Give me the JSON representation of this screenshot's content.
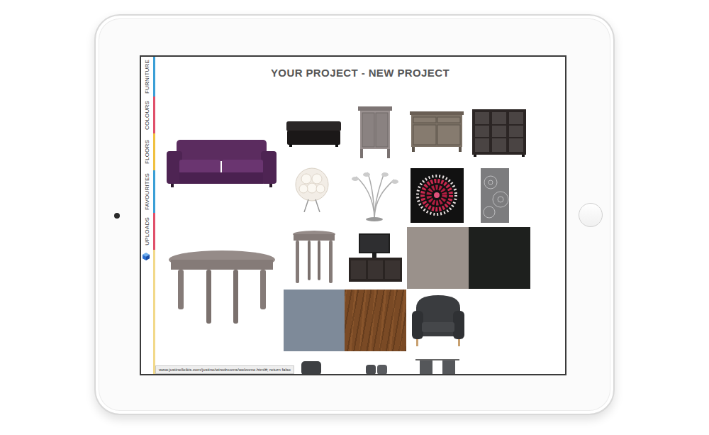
{
  "title": "YOUR PROJECT - NEW PROJECT",
  "sidebar": {
    "items": [
      {
        "label": "FURNITURE",
        "color": "#3b9fd6"
      },
      {
        "label": "COLOURS",
        "color": "#e0506a"
      },
      {
        "label": "FLOORS",
        "color": "#f0c040"
      },
      {
        "label": "FAVOURITES",
        "color": "#3b9fd6"
      },
      {
        "label": "UPLOADS",
        "color": "#e0506a"
      }
    ]
  },
  "swatches": [
    {
      "kind": "paint",
      "color": "#9a918b"
    },
    {
      "kind": "paint",
      "color": "#1e201e"
    },
    {
      "kind": "paint",
      "color": "#7e8a99"
    },
    {
      "kind": "texture",
      "color": "#7a4a25"
    }
  ],
  "status_bar": "www.justinelleikis.com/justine/wiredrooms/welcome.html#; return false"
}
